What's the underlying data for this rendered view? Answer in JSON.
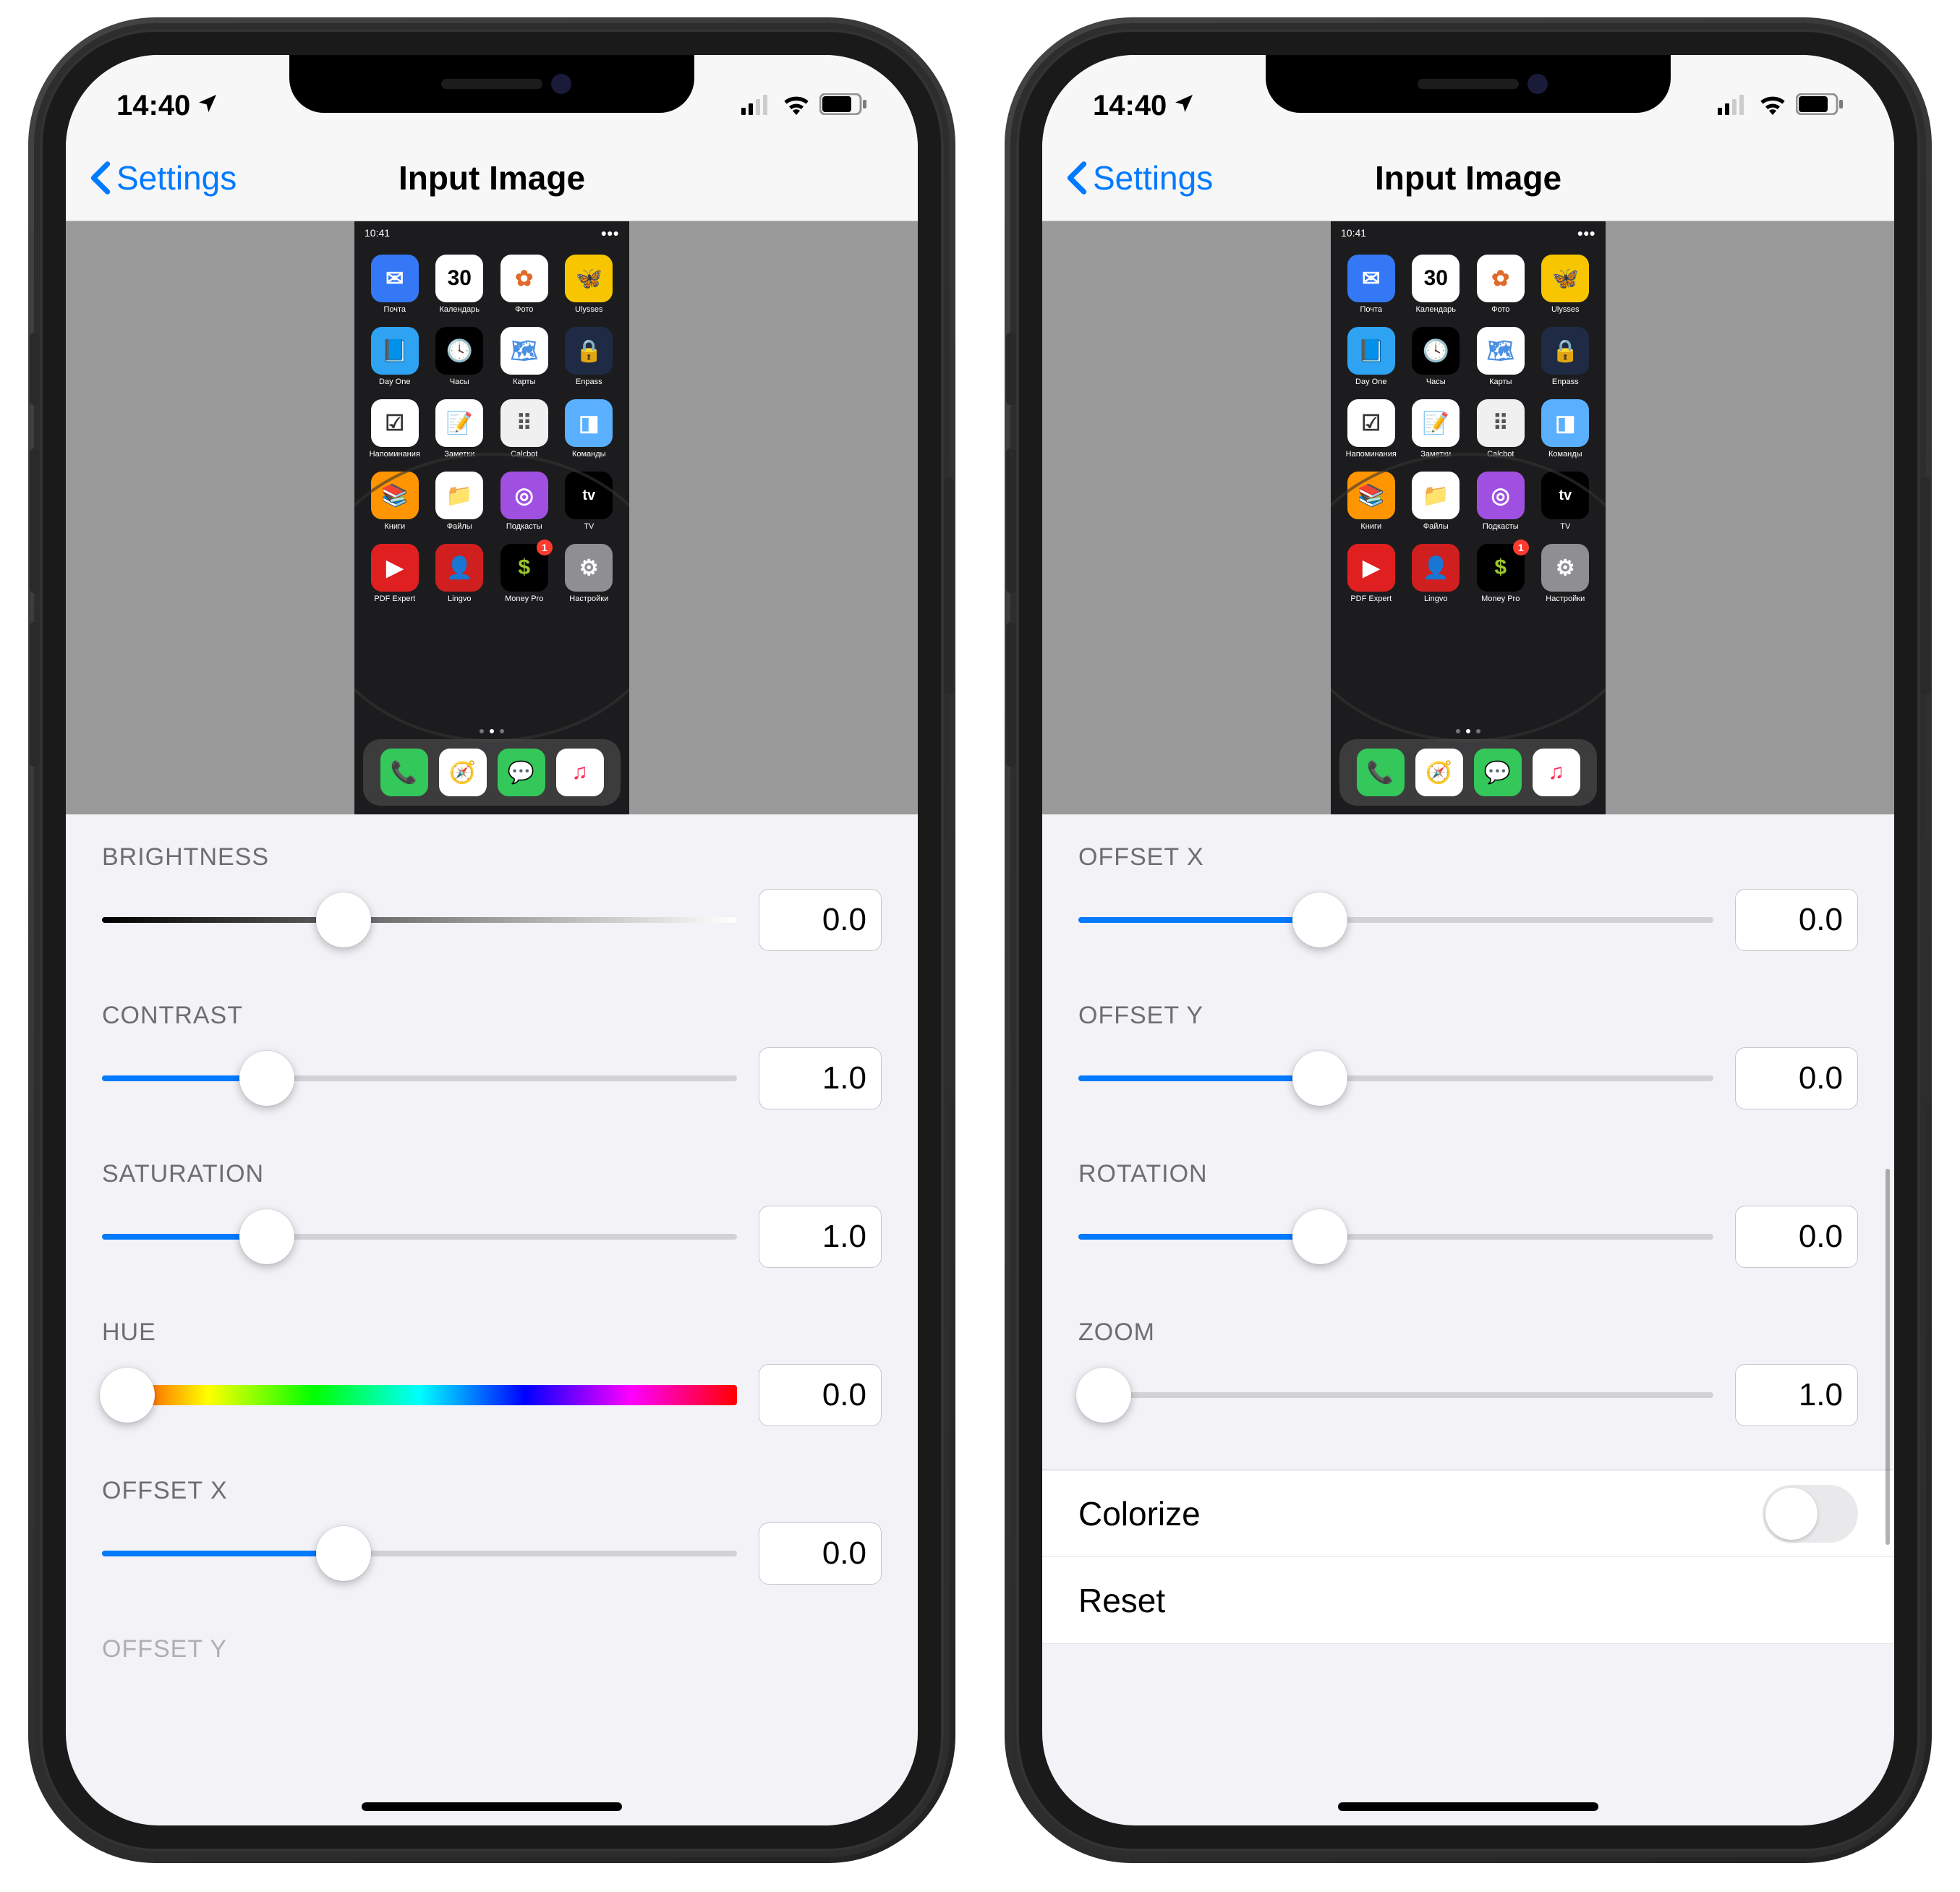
{
  "status": {
    "time": "14:40",
    "loc_icon": "location-arrow",
    "signal": "signal-icon",
    "wifi": "wifi-icon",
    "battery": "battery-icon"
  },
  "nav": {
    "back": "Settings",
    "title": "Input Image"
  },
  "thumb": {
    "status_time": "10:41",
    "apps": [
      {
        "label": "Почта",
        "bg": "#3478f6",
        "glyph": "✉︎"
      },
      {
        "label": "Календарь",
        "bg": "#ffffff",
        "glyph": "30",
        "fg": "#000"
      },
      {
        "label": "Фото",
        "bg": "#ffffff",
        "glyph": "✿",
        "fg": "#e06a2b"
      },
      {
        "label": "Ulysses",
        "bg": "#f7c600",
        "glyph": "🦋",
        "fg": "#000"
      },
      {
        "label": "Day One",
        "bg": "#2ea3f2",
        "glyph": "📘"
      },
      {
        "label": "Часы",
        "bg": "#000000",
        "glyph": "🕓"
      },
      {
        "label": "Карты",
        "bg": "#ffffff",
        "glyph": "🗺",
        "fg": "#4a90e2"
      },
      {
        "label": "Enpass",
        "bg": "#1f2a44",
        "glyph": "🔒"
      },
      {
        "label": "Напоминания",
        "bg": "#ffffff",
        "glyph": "☑︎",
        "fg": "#333"
      },
      {
        "label": "Заметки",
        "bg": "#ffffff",
        "glyph": "📝",
        "fg": "#f7b500"
      },
      {
        "label": "Calcbot",
        "bg": "#f0f0f0",
        "glyph": "⠿",
        "fg": "#555"
      },
      {
        "label": "Команды",
        "bg": "#5ab0ff",
        "glyph": "◨"
      },
      {
        "label": "Книги",
        "bg": "#ff9500",
        "glyph": "📚"
      },
      {
        "label": "Файлы",
        "bg": "#ffffff",
        "glyph": "📁",
        "fg": "#3478f6"
      },
      {
        "label": "Подкасты",
        "bg": "#a050e0",
        "glyph": "◎"
      },
      {
        "label": "TV",
        "bg": "#000000",
        "glyph": "tv",
        "fg": "#fff",
        "sz": "20"
      },
      {
        "label": "PDF Expert",
        "bg": "#e02020",
        "glyph": "▶"
      },
      {
        "label": "Lingvo",
        "bg": "#d01f1f",
        "glyph": "👤"
      },
      {
        "label": "Money Pro",
        "bg": "#000000",
        "glyph": "$",
        "fg": "#9cc82b",
        "badge": "1"
      },
      {
        "label": "Настройки",
        "bg": "#8e8e93",
        "glyph": "⚙︎"
      }
    ],
    "dock": [
      {
        "bg": "#34c759",
        "glyph": "📞"
      },
      {
        "bg": "#ffffff",
        "glyph": "🧭",
        "fg": "#3478f6"
      },
      {
        "bg": "#34c759",
        "glyph": "💬"
      },
      {
        "bg": "#ffffff",
        "glyph": "♫",
        "fg": "#ff2d55"
      }
    ]
  },
  "left": {
    "sliders": [
      {
        "key": "brightness",
        "label": "BRIGHTNESS",
        "value": "0.0",
        "track": "bw",
        "knob": 38
      },
      {
        "key": "contrast",
        "label": "CONTRAST",
        "value": "1.0",
        "track": "blue",
        "fill": 26,
        "knob": 26
      },
      {
        "key": "saturation",
        "label": "SATURATION",
        "value": "1.0",
        "track": "blue",
        "fill": 26,
        "knob": 26
      },
      {
        "key": "hue",
        "label": "HUE",
        "value": "0.0",
        "track": "hue",
        "knob": 4
      },
      {
        "key": "offsetx",
        "label": "OFFSET X",
        "value": "0.0",
        "track": "blue",
        "fill": 38,
        "knob": 38
      }
    ],
    "cutoff": "OFFSET Y"
  },
  "right": {
    "sliders": [
      {
        "key": "offsetx",
        "label": "OFFSET X",
        "value": "0.0",
        "track": "blue",
        "fill": 38,
        "knob": 38
      },
      {
        "key": "offsety",
        "label": "OFFSET Y",
        "value": "0.0",
        "track": "blue",
        "fill": 38,
        "knob": 38
      },
      {
        "key": "rotation",
        "label": "ROTATION",
        "value": "0.0",
        "track": "blue",
        "fill": 38,
        "knob": 38
      },
      {
        "key": "zoom",
        "label": "ZOOM",
        "value": "1.0",
        "track": "blue",
        "fill": 0,
        "knob": 4
      }
    ],
    "rows": [
      {
        "key": "colorize",
        "label": "Colorize",
        "type": "toggle",
        "on": false
      },
      {
        "key": "reset",
        "label": "Reset",
        "type": "button"
      }
    ]
  }
}
